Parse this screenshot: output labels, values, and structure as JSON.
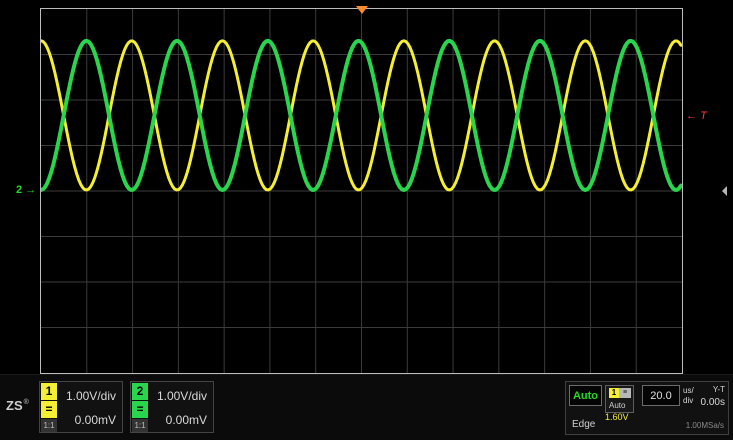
{
  "screen": {
    "trigger_marker_label": "T",
    "ch2_marker_label": "2"
  },
  "channels": [
    {
      "number": "1",
      "scale": "1.00V/div",
      "offset": "0.00mV",
      "coupling": "=",
      "probe": "1:1",
      "color": "#f4ef33",
      "waveform": "sine"
    },
    {
      "number": "2",
      "scale": "1.00V/div",
      "offset": "0.00mV",
      "coupling": "=",
      "probe": "1:1",
      "color": "#28d54c",
      "waveform": "sine"
    }
  ],
  "status": {
    "logo": "ZS",
    "logo_mark": "®",
    "mode": "Auto",
    "mode_small": "Auto",
    "mini_channel": "1",
    "mini_icon": "≡",
    "trigger_type": "Edge",
    "trigger_level": "1.60V",
    "timebase": "20.0",
    "time_unit": "us/",
    "time_div": "div",
    "display_mode": "Y-T",
    "display_value": "0.00s",
    "sample_rate": "1.00MSa/s"
  },
  "colors": {
    "background": "#000000",
    "grid": "#3b3b3b",
    "grid_frame": "#bcbcbc",
    "trigger": "#ff8a2b",
    "channel_1": "#f4ef33",
    "channel_2": "#28d54c"
  }
}
